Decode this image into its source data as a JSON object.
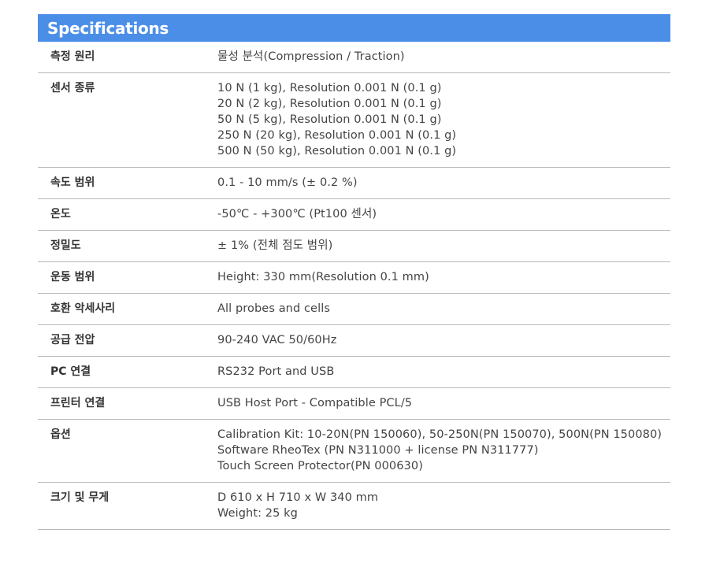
{
  "header": {
    "title": "Specifications"
  },
  "specs": [
    {
      "label": "측정 원리",
      "lines": [
        "물성 분석(Compression / Traction)"
      ]
    },
    {
      "label": "센서 종류",
      "lines": [
        "10 N (1 kg), Resolution 0.001 N (0.1 g)",
        "20 N (2 kg), Resolution 0.001 N (0.1 g)",
        "50 N (5 kg), Resolution 0.001 N (0.1 g)",
        "250 N (20 kg), Resolution 0.001 N (0.1 g)",
        "500 N (50 kg), Resolution 0.001 N (0.1 g)"
      ]
    },
    {
      "label": "속도 범위",
      "lines": [
        "0.1 - 10 mm/s (± 0.2 %)"
      ]
    },
    {
      "label": "온도",
      "lines": [
        "-50℃ - +300℃ (Pt100 센서)"
      ]
    },
    {
      "label": "정밀도",
      "lines": [
        "± 1% (전체 점도 범위)"
      ]
    },
    {
      "label": "운동 범위",
      "lines": [
        "Height: 330 mm(Resolution 0.1 mm)"
      ]
    },
    {
      "label": "호환 악세사리",
      "lines": [
        "All probes and cells"
      ]
    },
    {
      "label": "공급 전압",
      "lines": [
        "90-240 VAC 50/60Hz"
      ]
    },
    {
      "label": "PC 연결",
      "lines": [
        "RS232 Port and USB"
      ]
    },
    {
      "label": "프린터 연결",
      "lines": [
        "USB Host Port - Compatible PCL/5"
      ]
    },
    {
      "label": "옵션",
      "lines": [
        "Calibration Kit: 10-20N(PN 150060), 50-250N(PN 150070), 500N(PN 150080)",
        "Software RheoTex (PN N311000 + license PN N311777)",
        "Touch Screen Protector(PN 000630)"
      ]
    },
    {
      "label": "크기 및 무게",
      "lines": [
        "D 610 x H 710 x W 340 mm",
        "Weight: 25 kg"
      ]
    }
  ],
  "colors": {
    "header_bg": "#4a8ee8",
    "header_text": "#ffffff",
    "divider": "#b8b8b8"
  }
}
